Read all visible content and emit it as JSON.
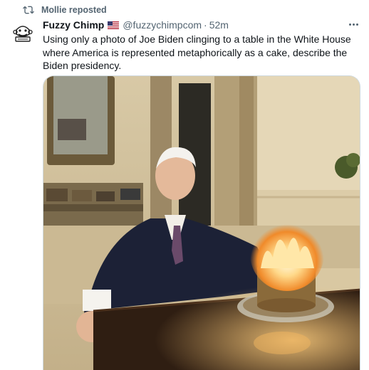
{
  "repost": {
    "label": "Mollie reposted",
    "icon": "repost-icon"
  },
  "author": {
    "name": "Fuzzy Chimp",
    "flag": "us-flag-icon",
    "handle": "@fuzzychimpcom",
    "separator": "·",
    "time": "52m",
    "avatar_icon": "chimp-avatar-icon"
  },
  "tweet": {
    "text": "Using only a photo of Joe Biden clinging to a table in the White House where America is represented metaphorically as a cake, describe the Biden presidency."
  },
  "media": {
    "description_icon": "photo-image"
  },
  "colors": {
    "text": "#0f1419",
    "secondary": "#536471",
    "border": "#cfd9de"
  }
}
